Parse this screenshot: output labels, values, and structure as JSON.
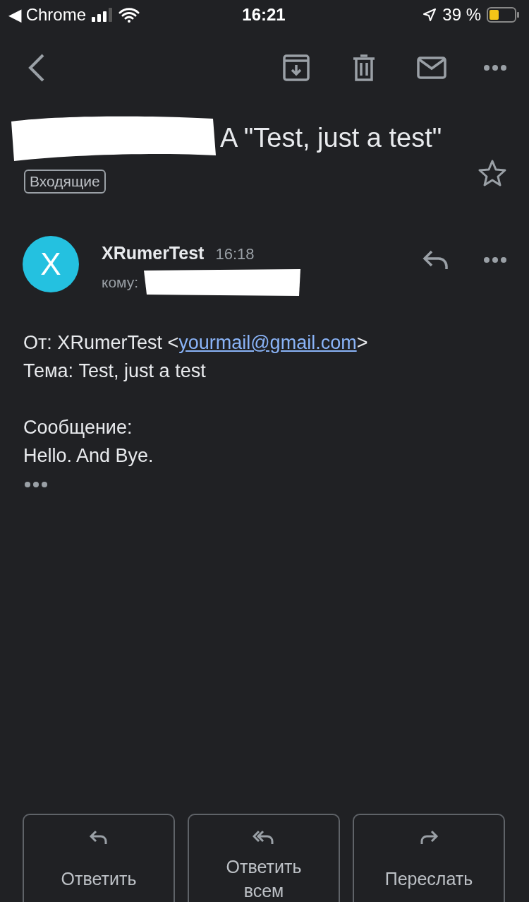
{
  "status_bar": {
    "back_app": "◀ Chrome",
    "time": "16:21",
    "battery": "39 %"
  },
  "subject": {
    "text": "A \"Test, just a test\"",
    "label": "Входящие",
    "starred": false
  },
  "message": {
    "avatar": "X",
    "sender": "XRumerTest",
    "time": "16:18",
    "to_label": "кому:",
    "from_label": "От: XRumerTest <",
    "from_email": "yourmail@gmail.com",
    "from_end": ">",
    "paragraphs": [
      [
        "Тема: Test, just a test"
      ],
      [
        "Сообщение:",
        "Hello. And Bye."
      ]
    ]
  },
  "actions": [
    {
      "kind": "reply",
      "label": "Ответить"
    },
    {
      "kind": "reply_all",
      "label": "Ответить всем"
    },
    {
      "kind": "forward",
      "label": "Переслать"
    }
  ]
}
